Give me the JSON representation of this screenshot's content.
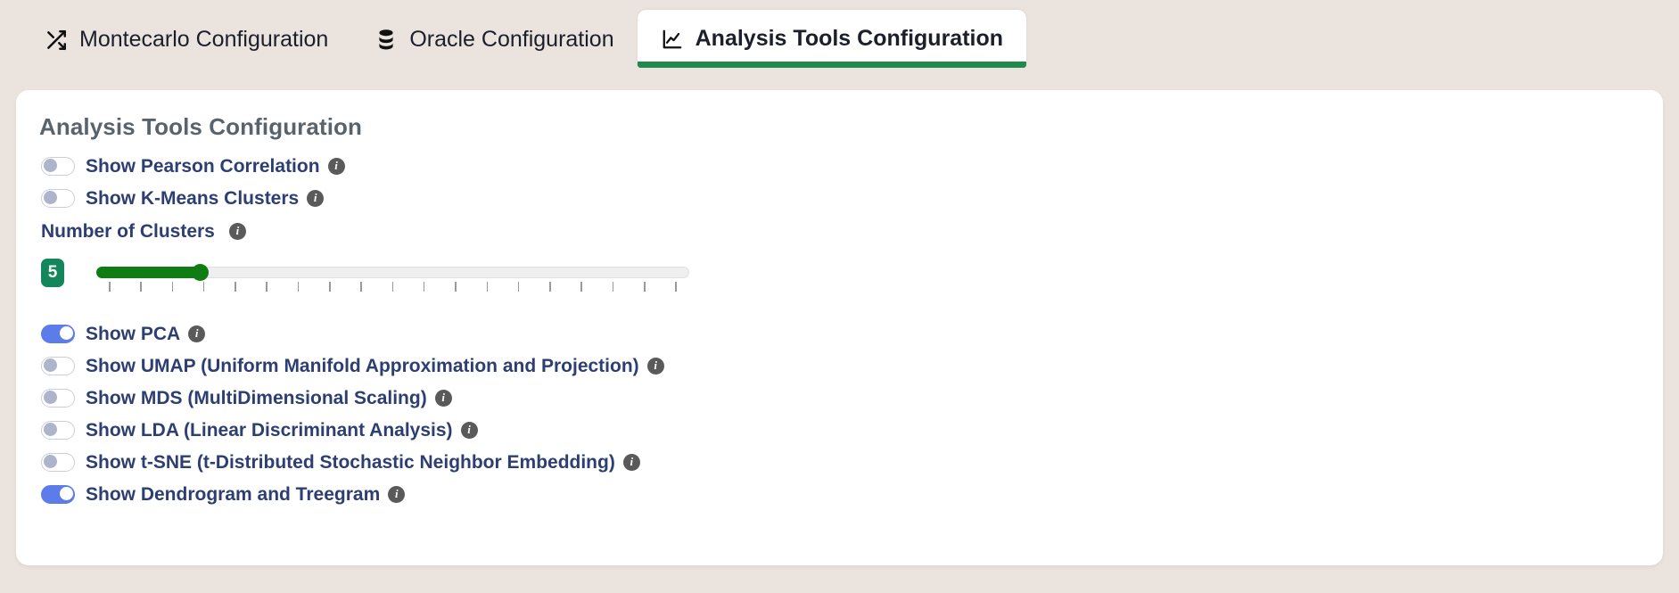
{
  "theme": {
    "page_background": "#EAE3DE",
    "card_background": "#FFFFFF",
    "accent_green": "#1F8A4C",
    "toggle_on_color": "#5C7CEA",
    "toggle_off_knob": "#AEB4CB",
    "slider_fill": "#0F7D14",
    "slider_badge": "#14865B",
    "label_color": "#2C3E72",
    "title_color": "#59636E"
  },
  "tabs": [
    {
      "id": "montecarlo",
      "label": "Montecarlo Configuration",
      "icon": "shuffle-icon",
      "active": false
    },
    {
      "id": "oracle",
      "label": "Oracle Configuration",
      "icon": "database-icon",
      "active": false
    },
    {
      "id": "analysis-tools",
      "label": "Analysis Tools Configuration",
      "icon": "chart-line-icon",
      "active": true
    }
  ],
  "card": {
    "title": "Analysis Tools Configuration",
    "info_glyph": "i",
    "toggles_top": [
      {
        "id": "pearson-correlation",
        "label": "Show Pearson Correlation",
        "state": "off",
        "has_info": true
      },
      {
        "id": "kmeans-clusters",
        "label": "Show K-Means Clusters",
        "state": "off",
        "has_info": true
      }
    ],
    "cluster_field": {
      "label": "Number of Clusters",
      "has_info": true,
      "value": "5",
      "min": 2,
      "max": 20,
      "tick_count": 19,
      "fill_percent": 18
    },
    "toggles_bottom": [
      {
        "id": "pca",
        "label": "Show PCA",
        "state": "on",
        "has_info": true
      },
      {
        "id": "umap",
        "label": "Show UMAP (Uniform Manifold Approximation and Projection)",
        "state": "off",
        "has_info": true
      },
      {
        "id": "mds",
        "label": "Show MDS (MultiDimensional Scaling)",
        "state": "off",
        "has_info": true
      },
      {
        "id": "lda",
        "label": "Show LDA (Linear Discriminant Analysis)",
        "state": "off",
        "has_info": true
      },
      {
        "id": "tsne",
        "label": "Show t-SNE (t-Distributed Stochastic Neighbor Embedding)",
        "state": "off",
        "has_info": true
      },
      {
        "id": "dendrogram",
        "label": "Show Dendrogram and Treegram",
        "state": "on",
        "has_info": true
      }
    ]
  }
}
